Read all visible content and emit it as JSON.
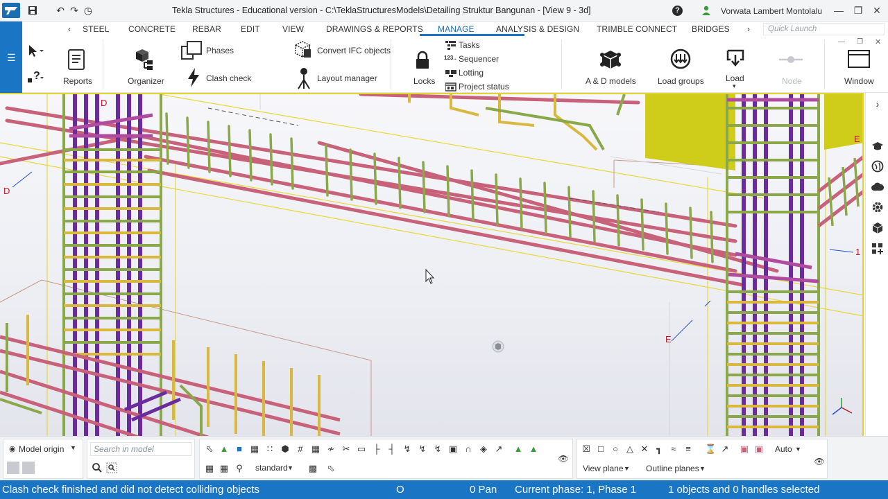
{
  "titlebar": {
    "title": "Tekla Structures - Educational version - C:\\TeklaStructuresModels\\Detailing Struktur Bangunan  - [View 9 - 3d]",
    "user_name": "Vorwata Lambert Montolalu"
  },
  "tabs": [
    {
      "label": "STEEL"
    },
    {
      "label": "CONCRETE"
    },
    {
      "label": "REBAR"
    },
    {
      "label": "EDIT"
    },
    {
      "label": "VIEW"
    },
    {
      "label": "DRAWINGS & REPORTS"
    },
    {
      "label": "MANAGE",
      "active": true
    },
    {
      "label": "ANALYSIS & DESIGN"
    },
    {
      "label": "TRIMBLE CONNECT"
    },
    {
      "label": "BRIDGES"
    }
  ],
  "quick_launch": {
    "placeholder": "Quick Launch"
  },
  "ribbon": {
    "reports": "Reports",
    "organizer": "Organizer",
    "phases": "Phases",
    "clash_check": "Clash check",
    "convert_ifc": "Convert IFC objects",
    "layout_manager": "Layout manager",
    "locks": "Locks",
    "tasks": "Tasks",
    "sequencer": "Sequencer",
    "lotting": "Lotting",
    "project_status": "Project status",
    "ad_models": "A & D models",
    "load_groups": "Load groups",
    "load": "Load",
    "node": "Node",
    "window": "Window"
  },
  "viewport": {
    "grid_labels": [
      "D",
      "D",
      "E",
      "E",
      "1"
    ]
  },
  "bottom": {
    "model_origin": "Model origin",
    "search_placeholder": "Search in model",
    "standard": "standard",
    "auto": "Auto",
    "view_plane": "View plane",
    "outline_planes": "Outline planes"
  },
  "status": {
    "message": "Clash check finished and did not detect colliding objects",
    "o": "O",
    "pan": "0 Pan",
    "phase": "Current phase: 1, Phase 1",
    "selection": "1 objects and 0 handles selected"
  },
  "colors": {
    "accent": "#1a75c4",
    "rebar_green": "#8aa84a",
    "rebar_pink": "#c8617a",
    "rebar_purple": "#6a2c9c",
    "rebar_yellow": "#d9b840",
    "panel_yellow": "#cfcc1a",
    "grid_red": "#c01824"
  }
}
